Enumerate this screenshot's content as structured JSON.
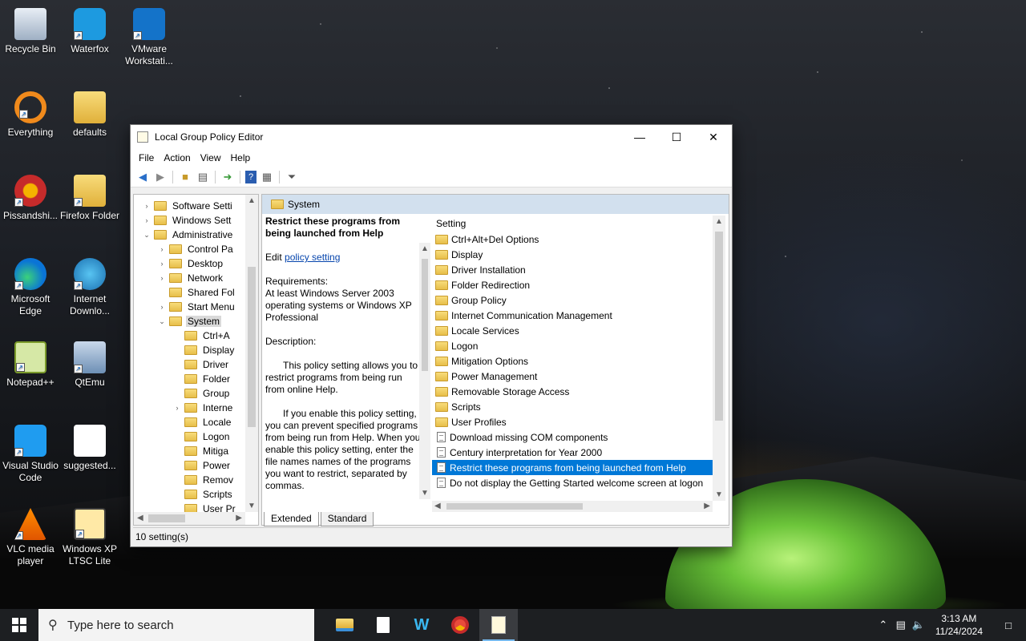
{
  "desktop": {
    "icons": [
      {
        "label": "Recycle Bin"
      },
      {
        "label": "Waterfox"
      },
      {
        "label": "VMware Workstati..."
      },
      {
        "label": "Everything"
      },
      {
        "label": "defaults"
      },
      {
        "label": "Pissandshi..."
      },
      {
        "label": "Firefox Folder"
      },
      {
        "label": "Microsoft Edge"
      },
      {
        "label": "Internet Downlo..."
      },
      {
        "label": "Notepad++"
      },
      {
        "label": "QtEmu"
      },
      {
        "label": "Visual Studio Code"
      },
      {
        "label": "suggested..."
      },
      {
        "label": "VLC media player"
      },
      {
        "label": "Windows XP LTSC Lite"
      }
    ]
  },
  "window": {
    "title": "Local Group Policy Editor",
    "menu": [
      "File",
      "Action",
      "View",
      "Help"
    ],
    "tree": [
      {
        "label": "Software Setti",
        "level": 1,
        "arrow": ">"
      },
      {
        "label": "Windows Sett",
        "level": 1,
        "arrow": ">"
      },
      {
        "label": "Administrative",
        "level": 1,
        "arrow": "v"
      },
      {
        "label": "Control Pa",
        "level": 2,
        "arrow": ">"
      },
      {
        "label": "Desktop",
        "level": 2,
        "arrow": ">"
      },
      {
        "label": "Network",
        "level": 2,
        "arrow": ">"
      },
      {
        "label": "Shared Fol",
        "level": 2,
        "arrow": ""
      },
      {
        "label": "Start Menu",
        "level": 2,
        "arrow": ">"
      },
      {
        "label": "System",
        "level": 2,
        "arrow": "v",
        "selected": true
      },
      {
        "label": "Ctrl+A",
        "level": 3,
        "arrow": ""
      },
      {
        "label": "Display",
        "level": 3,
        "arrow": ""
      },
      {
        "label": "Driver",
        "level": 3,
        "arrow": ""
      },
      {
        "label": "Folder",
        "level": 3,
        "arrow": ""
      },
      {
        "label": "Group",
        "level": 3,
        "arrow": ""
      },
      {
        "label": "Interne",
        "level": 3,
        "arrow": ">"
      },
      {
        "label": "Locale",
        "level": 3,
        "arrow": ""
      },
      {
        "label": "Logon",
        "level": 3,
        "arrow": ""
      },
      {
        "label": "Mitiga",
        "level": 3,
        "arrow": ""
      },
      {
        "label": "Power",
        "level": 3,
        "arrow": ""
      },
      {
        "label": "Remov",
        "level": 3,
        "arrow": ""
      },
      {
        "label": "Scripts",
        "level": 3,
        "arrow": ""
      },
      {
        "label": "User Pr",
        "level": 3,
        "arrow": ""
      }
    ],
    "pane_header": "System",
    "description": {
      "title": "Restrict these programs from being launched from Help",
      "edit_prefix": "Edit ",
      "edit_link": "policy setting",
      "requirements_label": "Requirements:",
      "requirements": "At least Windows Server 2003 operating systems or Windows XP Professional",
      "description_label": "Description:",
      "para1": "This policy setting allows you to restrict programs from being run from online Help.",
      "para2": "If you enable this policy setting, you can prevent specified programs from being run from Help. When you enable this policy setting, enter the file names names of the programs you want to restrict, separated by commas."
    },
    "list_header": "Setting",
    "list": [
      {
        "label": "Ctrl+Alt+Del Options",
        "type": "folder"
      },
      {
        "label": "Display",
        "type": "folder"
      },
      {
        "label": "Driver Installation",
        "type": "folder"
      },
      {
        "label": "Folder Redirection",
        "type": "folder"
      },
      {
        "label": "Group Policy",
        "type": "folder"
      },
      {
        "label": "Internet Communication Management",
        "type": "folder"
      },
      {
        "label": "Locale Services",
        "type": "folder"
      },
      {
        "label": "Logon",
        "type": "folder"
      },
      {
        "label": "Mitigation Options",
        "type": "folder"
      },
      {
        "label": "Power Management",
        "type": "folder"
      },
      {
        "label": "Removable Storage Access",
        "type": "folder"
      },
      {
        "label": "Scripts",
        "type": "folder"
      },
      {
        "label": "User Profiles",
        "type": "folder"
      },
      {
        "label": "Download missing COM components",
        "type": "setting"
      },
      {
        "label": "Century interpretation for Year 2000",
        "type": "setting"
      },
      {
        "label": "Restrict these programs from being launched from Help",
        "type": "setting",
        "selected": true
      },
      {
        "label": "Do not display the Getting Started welcome screen at logon",
        "type": "setting"
      }
    ],
    "tabs": [
      "Extended",
      "Standard"
    ],
    "status": "10 setting(s)"
  },
  "taskbar": {
    "search_placeholder": "Type here to search",
    "time": "3:13 AM",
    "date": "11/24/2024"
  },
  "colors": {
    "selection": "#0078d7",
    "pane_header": "#d2e0ee"
  }
}
